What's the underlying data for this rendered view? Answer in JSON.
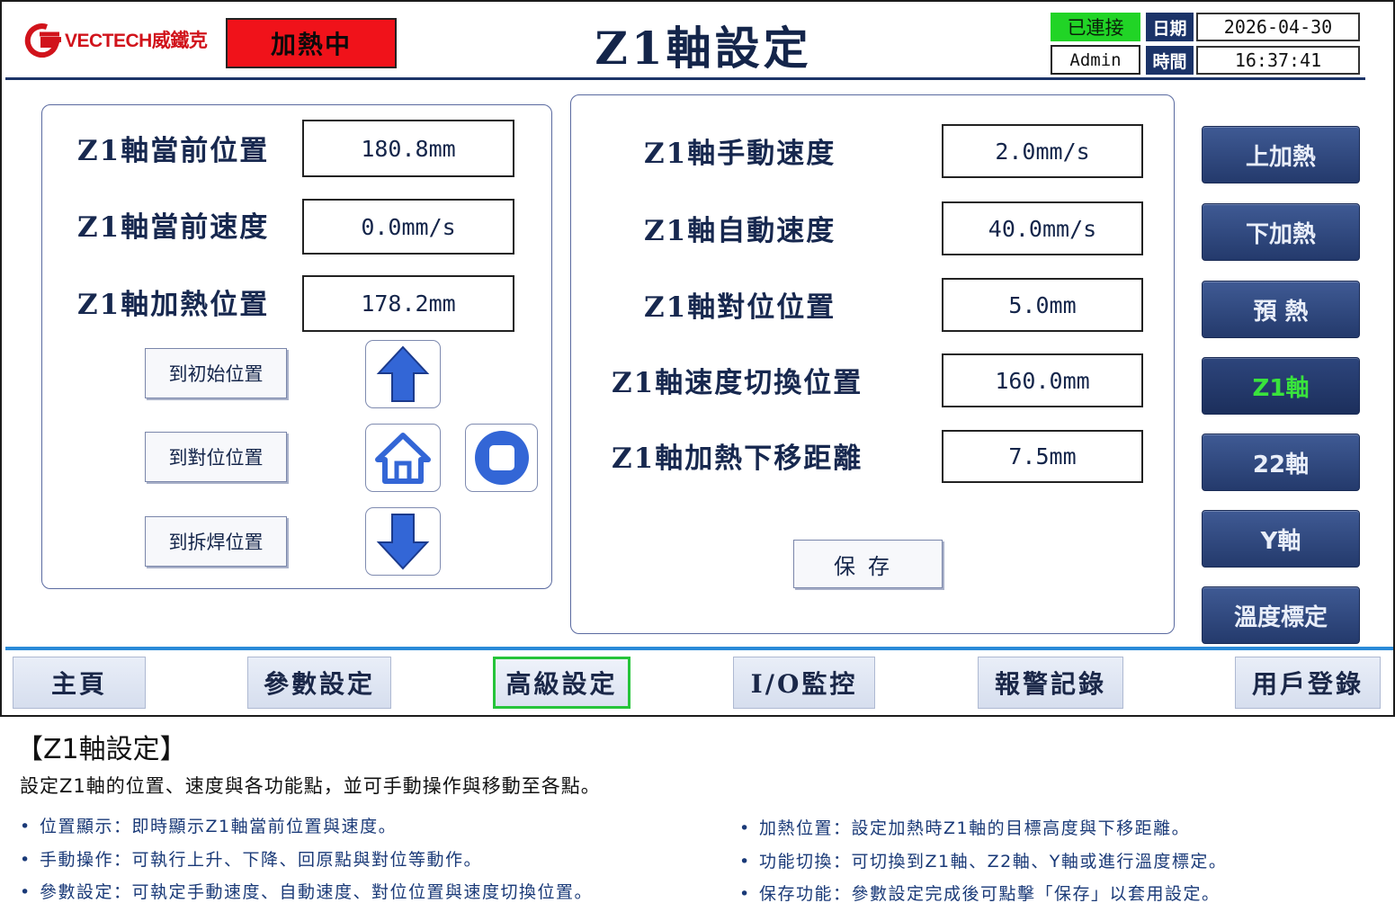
{
  "header": {
    "brand": "VECTECH威鐵克",
    "heat_status": "加熱中",
    "title": "Z1軸設定",
    "connection": "已連接",
    "user": "Admin",
    "date_label": "日期",
    "date_value": "2026-04-30",
    "time_label": "時間",
    "time_value": "16:37:41"
  },
  "status": {
    "heating": "加熱中"
  },
  "left_panel": {
    "rows": [
      {
        "label": "Z1軸當前位置",
        "value": "180.8mm"
      },
      {
        "label": "Z1軸當前速度",
        "value": "0.0mm/s"
      },
      {
        "label": "Z1軸加熱位置",
        "value": "178.2mm"
      }
    ],
    "buttons": {
      "goto_home": "到初始位置",
      "goto_align": "到對位位置",
      "goto_desolder": "到拆焊位置"
    },
    "icons": [
      "arrow-up-icon",
      "home-icon",
      "stop-icon",
      "arrow-down-icon"
    ]
  },
  "right_panel": {
    "rows": [
      {
        "label": "Z1軸手動速度",
        "value": "2.0mm/s"
      },
      {
        "label": "Z1軸自動速度",
        "value": "40.0mm/s"
      },
      {
        "label": "Z1軸對位位置",
        "value": "5.0mm"
      },
      {
        "label": "Z1軸速度切換位置",
        "value": "160.0mm"
      },
      {
        "label": "Z1軸加熱下移距離",
        "value": "7.5mm"
      }
    ],
    "save_label": "保存"
  },
  "side_nav": {
    "items": [
      {
        "label": "上加熱"
      },
      {
        "label": "下加熱"
      },
      {
        "label": "預 熱"
      },
      {
        "label": "Z1軸",
        "active": true
      },
      {
        "label": "22軸"
      },
      {
        "label": "Y軸"
      },
      {
        "label": "溫度標定"
      }
    ]
  },
  "bottom_nav": {
    "items": [
      {
        "label": "主頁"
      },
      {
        "label": "參數設定"
      },
      {
        "label": "高級設定",
        "active": true
      },
      {
        "label": "I/O監控"
      },
      {
        "label": "報警記錄"
      },
      {
        "label": "用戶登錄"
      }
    ]
  },
  "caption": {
    "title": "【Z1軸設定】",
    "description": "設定Z1軸的位置、速度與各功能點，並可手動操作與移動至各點。",
    "bullets_left": [
      "位置顯示：即時顯示Z1軸當前位置與速度。",
      "手動操作：可執行上升、下降、回原點與對位等動作。",
      "參數設定：可執定手動速度、自動速度、對位位置與速度切換位置。"
    ],
    "bullets_right": [
      "加熱位置：設定加熱時Z1軸的目標高度與下移距離。",
      "功能切換：可切換到Z1軸、Z2軸、Y軸或進行溫度標定。",
      "保存功能：參數設定完成後可點擊「保存」以套用設定。"
    ]
  },
  "colors": {
    "heat_red": "#f0121a",
    "connected_green": "#21d426",
    "navy": "#1c3468",
    "active_green": "#39e33c",
    "accent_blue": "#2a8ad8"
  }
}
